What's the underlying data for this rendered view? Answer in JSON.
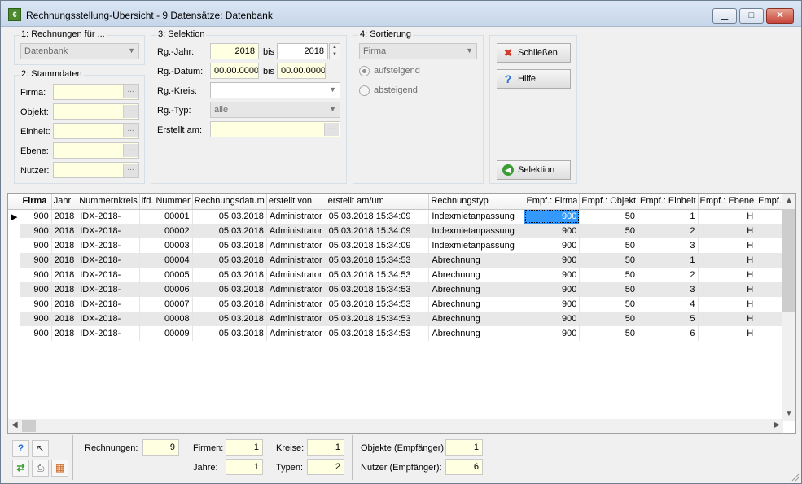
{
  "window": {
    "title": "Rechnungsstellung-Übersicht - 9 Datensätze: Datenbank",
    "icon_name": "app-icon",
    "minimize": "▁",
    "maximize": "□",
    "close": "✕"
  },
  "rechnungen_fuer": {
    "title": "1: Rechnungen für ...",
    "value": "Datenbank"
  },
  "stammdaten": {
    "title": "2: Stammdaten",
    "fields": [
      {
        "label": "Firma:",
        "value": ""
      },
      {
        "label": "Objekt:",
        "value": ""
      },
      {
        "label": "Einheit:",
        "value": ""
      },
      {
        "label": "Ebene:",
        "value": ""
      },
      {
        "label": "Nutzer:",
        "value": ""
      }
    ],
    "ellipsis": "..."
  },
  "selektion": {
    "title": "3: Selektion",
    "jahr_label": "Rg.-Jahr:",
    "jahr_from": "2018",
    "jahr_to": "2018",
    "bis": "bis",
    "datum_label": "Rg.-Datum:",
    "datum_from": "00.00.0000",
    "datum_to": "00.00.0000",
    "kreis_label": "Rg.-Kreis:",
    "kreis_value": "",
    "typ_label": "Rg.-Typ:",
    "typ_value": "alle",
    "erstellt_label": "Erstellt am:",
    "erstellt_value": ""
  },
  "sortierung": {
    "title": "4: Sortierung",
    "value": "Firma",
    "asc": "aufsteigend",
    "desc": "absteigend",
    "selected": "asc"
  },
  "buttons": {
    "schliessen": "Schließen",
    "hilfe": "Hilfe",
    "selektion": "Selektion"
  },
  "grid": {
    "columns": [
      "Firma",
      "Jahr",
      "Nummernkreis",
      "lfd. Nummer",
      "Rechnungsdatum",
      "erstellt von",
      "erstellt am/um",
      "Rechnungstyp",
      "Empf.: Firma",
      "Empf.: Objekt",
      "Empf.: Einheit",
      "Empf.: Ebene",
      "Empf.: N"
    ],
    "rows": [
      [
        "900",
        "2018",
        "IDX-2018-",
        "00001",
        "05.03.2018",
        "Administrator",
        "05.03.2018 15:34:09",
        "Indexmietanpassung",
        "900",
        "50",
        "1",
        "H",
        ""
      ],
      [
        "900",
        "2018",
        "IDX-2018-",
        "00002",
        "05.03.2018",
        "Administrator",
        "05.03.2018 15:34:09",
        "Indexmietanpassung",
        "900",
        "50",
        "2",
        "H",
        ""
      ],
      [
        "900",
        "2018",
        "IDX-2018-",
        "00003",
        "05.03.2018",
        "Administrator",
        "05.03.2018 15:34:09",
        "Indexmietanpassung",
        "900",
        "50",
        "3",
        "H",
        ""
      ],
      [
        "900",
        "2018",
        "IDX-2018-",
        "00004",
        "05.03.2018",
        "Administrator",
        "05.03.2018 15:34:53",
        "Abrechnung",
        "900",
        "50",
        "1",
        "H",
        ""
      ],
      [
        "900",
        "2018",
        "IDX-2018-",
        "00005",
        "05.03.2018",
        "Administrator",
        "05.03.2018 15:34:53",
        "Abrechnung",
        "900",
        "50",
        "2",
        "H",
        ""
      ],
      [
        "900",
        "2018",
        "IDX-2018-",
        "00006",
        "05.03.2018",
        "Administrator",
        "05.03.2018 15:34:53",
        "Abrechnung",
        "900",
        "50",
        "3",
        "H",
        ""
      ],
      [
        "900",
        "2018",
        "IDX-2018-",
        "00007",
        "05.03.2018",
        "Administrator",
        "05.03.2018 15:34:53",
        "Abrechnung",
        "900",
        "50",
        "4",
        "H",
        ""
      ],
      [
        "900",
        "2018",
        "IDX-2018-",
        "00008",
        "05.03.2018",
        "Administrator",
        "05.03.2018 15:34:53",
        "Abrechnung",
        "900",
        "50",
        "5",
        "H",
        ""
      ],
      [
        "900",
        "2018",
        "IDX-2018-",
        "00009",
        "05.03.2018",
        "Administrator",
        "05.03.2018 15:34:53",
        "Abrechnung",
        "900",
        "50",
        "6",
        "H",
        ""
      ]
    ],
    "current_row_marker": "▶"
  },
  "stats": {
    "rechnungen_label": "Rechnungen:",
    "rechnungen": "9",
    "firmen_label": "Firmen:",
    "firmen": "1",
    "kreise_label": "Kreise:",
    "kreise": "1",
    "jahre_label": "Jahre:",
    "jahre": "1",
    "typen_label": "Typen:",
    "typen": "2",
    "objekte_label": "Objekte (Empfänger):",
    "objekte": "1",
    "nutzer_label": "Nutzer (Empfänger):",
    "nutzer": "6"
  },
  "toolbar_icons": [
    "help-icon",
    "pointer-icon",
    "refresh-icon",
    "print-icon",
    "export-icon"
  ],
  "colors": {
    "accent": "#3399ff",
    "yellow_field": "#ffffe1",
    "title_bg": "#dbe6f3"
  }
}
